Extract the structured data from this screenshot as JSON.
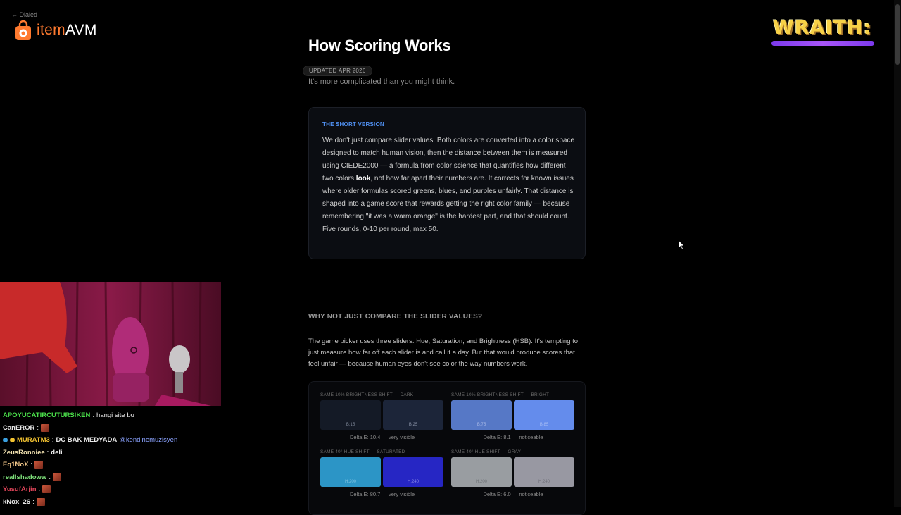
{
  "nav": {
    "back_label": "← Dialed"
  },
  "logo": {
    "item": "item",
    "rest": "AVM"
  },
  "overlay": {
    "wraith_text": "WRAITH:"
  },
  "page": {
    "title": "How Scoring Works",
    "badge": "UPDATED APR 2026",
    "subtitle": "It's more complicated than you might think."
  },
  "short_version": {
    "label": "THE SHORT VERSION",
    "text_1": "We don't just compare slider values. Both colors are converted into a color space designed to match human vision, then the distance between them is measured using CIEDE2000 — a formula from color science that quantifies how different two colors ",
    "bold": "look",
    "text_2": ", not how far apart their numbers are. It corrects for known issues where older formulas scored greens, blues, and purples unfairly. That distance is shaped into a game score that rewards getting the right color family — because remembering \"it was a warm orange\" is the hardest part, and that should count. Five rounds, 0-10 per round, max 50."
  },
  "why_section": {
    "heading": "WHY NOT JUST COMPARE THE SLIDER VALUES?",
    "body": "The game picker uses three sliders: Hue, Saturation, and Brightness (HSB). It's tempting to just measure how far off each slider is and call it a day. But that would produce scores that feel unfair — because human eyes don't see color the way numbers work."
  },
  "demos": [
    {
      "title": "SAME 10% BRIGHTNESS SHIFT — DARK",
      "swatches": [
        {
          "color": "#141a26",
          "label": "B:15",
          "label_color": "#7c8596"
        },
        {
          "color": "#1c2539",
          "label": "B:25",
          "label_color": "#8a93a8"
        }
      ],
      "delta": "Delta E: 10.4 — very visible"
    },
    {
      "title": "SAME 10% BRIGHTNESS SHIFT — BRIGHT",
      "swatches": [
        {
          "color": "#5678c6",
          "label": "B:75",
          "label_color": "#a7b8e6"
        },
        {
          "color": "#648cec",
          "label": "B:85",
          "label_color": "#a9bff5"
        }
      ],
      "delta": "Delta E: 8.1 — noticeable"
    },
    {
      "title": "SAME 40° HUE SHIFT — SATURATED",
      "swatches": [
        {
          "color": "#2c95c6",
          "label": "H:200",
          "label_color": "#7fc3e2"
        },
        {
          "color": "#2626c4",
          "label": "H:240",
          "label_color": "#8c8ce6"
        }
      ],
      "delta": "Delta E: 80.7 — very visible"
    },
    {
      "title": "SAME 40° HUE SHIFT — GRAY",
      "swatches": [
        {
          "color": "#999da1",
          "label": "H:200",
          "label_color": "#6e7276"
        },
        {
          "color": "#9898a2",
          "label": "H:240",
          "label_color": "#6c6c76"
        }
      ],
      "delta": "Delta E: 6.0 — noticeable"
    }
  ],
  "chat": [
    {
      "user": "APOYUCATIRCUTURSIKEN",
      "user_color": "#4ade4a",
      "message": "hangi site bu",
      "badges": false,
      "emote": false
    },
    {
      "user": "CanEROR",
      "user_color": "#e8e8e8",
      "message": "",
      "badges": false,
      "emote": true
    },
    {
      "user": "MURATM3",
      "user_color": "#f2c230",
      "message": "DC BAK MEDYADA",
      "mention": "@kendinemuzisyen",
      "badges": true,
      "emote": false
    },
    {
      "user": "ZeusRonniee",
      "user_color": "#f2e2b0",
      "message": "deli",
      "badges": false,
      "emote": false
    },
    {
      "user": "Eq1NoX",
      "user_color": "#f4c88a",
      "message": "",
      "badges": false,
      "emote": true
    },
    {
      "user": "reallshadoww",
      "user_color": "#7ee07a",
      "message": "",
      "badges": false,
      "emote": true
    },
    {
      "user": "YusufArjin",
      "user_color": "#e2455a",
      "message": "",
      "badges": false,
      "emote": true
    },
    {
      "user": "kNox_26",
      "user_color": "#e8e8e8",
      "message": "",
      "badges": false,
      "emote": true
    }
  ]
}
